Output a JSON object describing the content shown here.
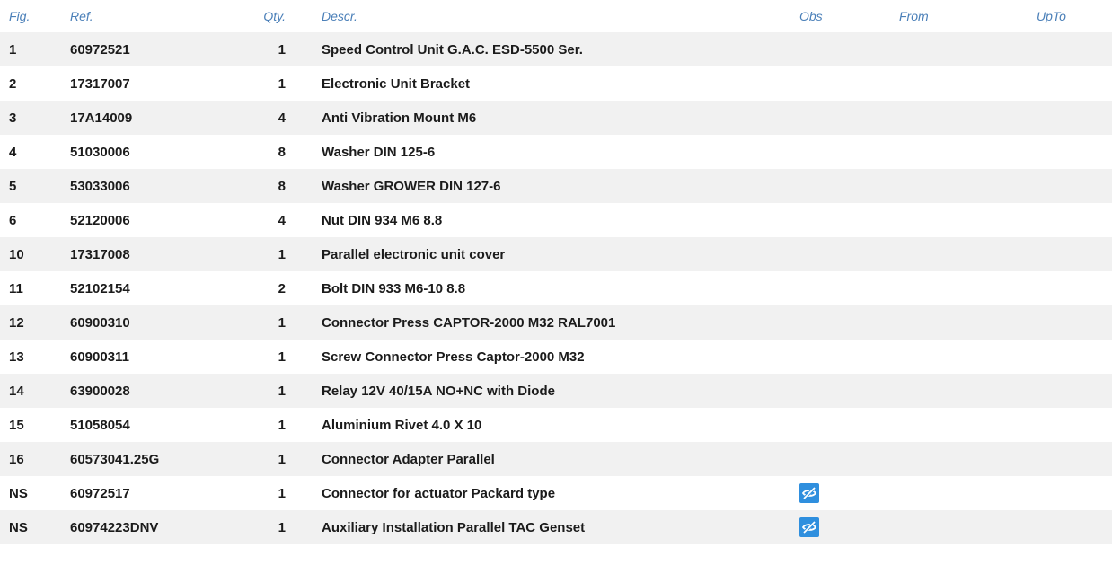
{
  "table": {
    "headers": {
      "fig": "Fig.",
      "ref": "Ref.",
      "qty": "Qty.",
      "descr": "Descr.",
      "obs": "Obs",
      "from": "From",
      "upto": "UpTo"
    },
    "rows": [
      {
        "fig": "1",
        "ref": "60972521",
        "qty": "1",
        "descr": "Speed Control Unit G.A.C. ESD-5500 Ser.",
        "obs": false,
        "from": "",
        "upto": ""
      },
      {
        "fig": "2",
        "ref": "17317007",
        "qty": "1",
        "descr": "Electronic Unit Bracket",
        "obs": false,
        "from": "",
        "upto": ""
      },
      {
        "fig": "3",
        "ref": "17A14009",
        "qty": "4",
        "descr": "Anti Vibration Mount M6",
        "obs": false,
        "from": "",
        "upto": ""
      },
      {
        "fig": "4",
        "ref": "51030006",
        "qty": "8",
        "descr": "Washer DIN 125-6",
        "obs": false,
        "from": "",
        "upto": ""
      },
      {
        "fig": "5",
        "ref": "53033006",
        "qty": "8",
        "descr": "Washer GROWER DIN 127-6",
        "obs": false,
        "from": "",
        "upto": ""
      },
      {
        "fig": "6",
        "ref": "52120006",
        "qty": "4",
        "descr": "Nut DIN 934 M6 8.8",
        "obs": false,
        "from": "",
        "upto": ""
      },
      {
        "fig": "10",
        "ref": "17317008",
        "qty": "1",
        "descr": "Parallel electronic unit cover",
        "obs": false,
        "from": "",
        "upto": ""
      },
      {
        "fig": "11",
        "ref": "52102154",
        "qty": "2",
        "descr": "Bolt DIN 933 M6-10 8.8",
        "obs": false,
        "from": "",
        "upto": ""
      },
      {
        "fig": "12",
        "ref": "60900310",
        "qty": "1",
        "descr": "Connector Press CAPTOR-2000 M32 RAL7001",
        "obs": false,
        "from": "",
        "upto": ""
      },
      {
        "fig": "13",
        "ref": "60900311",
        "qty": "1",
        "descr": "Screw Connector Press Captor-2000 M32",
        "obs": false,
        "from": "",
        "upto": ""
      },
      {
        "fig": "14",
        "ref": "63900028",
        "qty": "1",
        "descr": "Relay 12V 40/15A NO+NC with Diode",
        "obs": false,
        "from": "",
        "upto": ""
      },
      {
        "fig": "15",
        "ref": "51058054",
        "qty": "1",
        "descr": "Aluminium Rivet 4.0 X 10",
        "obs": false,
        "from": "",
        "upto": ""
      },
      {
        "fig": "16",
        "ref": "60573041.25G",
        "qty": "1",
        "descr": "Connector Adapter Parallel",
        "obs": false,
        "from": "",
        "upto": ""
      },
      {
        "fig": "NS",
        "ref": "60972517",
        "qty": "1",
        "descr": "Connector for actuator Packard type",
        "obs": true,
        "from": "",
        "upto": ""
      },
      {
        "fig": "NS",
        "ref": "60974223DNV",
        "qty": "1",
        "descr": "Auxiliary Installation Parallel TAC Genset",
        "obs": true,
        "from": "",
        "upto": ""
      }
    ]
  },
  "icons": {
    "obs": "eye-slash-icon"
  },
  "colors": {
    "header_text": "#4a7fb8",
    "row_stripe": "#f1f1f1",
    "icon_bg": "#2f8fde"
  }
}
